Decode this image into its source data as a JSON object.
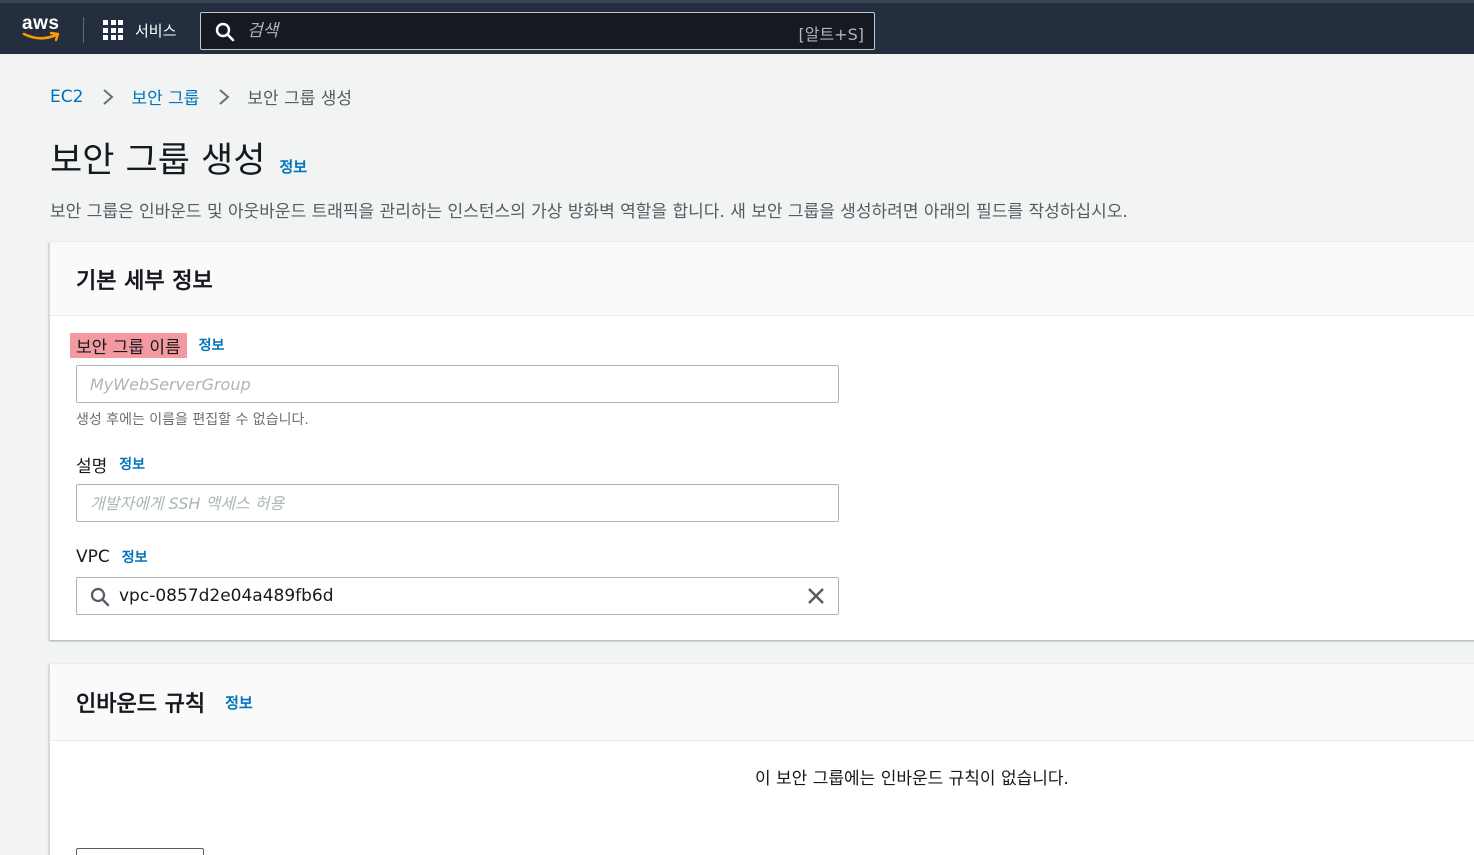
{
  "nav": {
    "logo_text": "aws",
    "services_label": "서비스",
    "search_placeholder": "검색",
    "search_shortcut": "[알트+S]"
  },
  "breadcrumb": {
    "items": [
      "EC2",
      "보안 그룹"
    ],
    "current": "보안 그룹 생성"
  },
  "page": {
    "title": "보안 그룹 생성",
    "info_link": "정보",
    "description": "보안 그룹은 인바운드 및 아웃바운드 트래픽을 관리하는 인스턴스의 가상 방화벽 역할을 합니다. 새 보안 그룹을 생성하려면 아래의 필드를 작성하십시오."
  },
  "basic_details": {
    "title": "기본 세부 정보",
    "name_field": {
      "label": "보안 그룹 이름",
      "info": "정보",
      "placeholder": "MyWebServerGroup",
      "value": "",
      "hint": "생성 후에는 이름을 편집할 수 없습니다."
    },
    "description_field": {
      "label": "설명",
      "info": "정보",
      "placeholder": "개발자에게 SSH 액세스 허용",
      "value": ""
    },
    "vpc_field": {
      "label": "VPC",
      "info": "정보",
      "value": "vpc-0857d2e04a489fb6d"
    }
  },
  "inbound_rules": {
    "title": "인바운드 규칙",
    "info": "정보",
    "empty_message": "이 보안 그룹에는 인바운드 규칙이 없습니다."
  },
  "colors": {
    "nav_bg": "#232f3e",
    "link": "#0073bb",
    "highlight": "#f29a9f",
    "page_bg": "#f2f3f3"
  }
}
